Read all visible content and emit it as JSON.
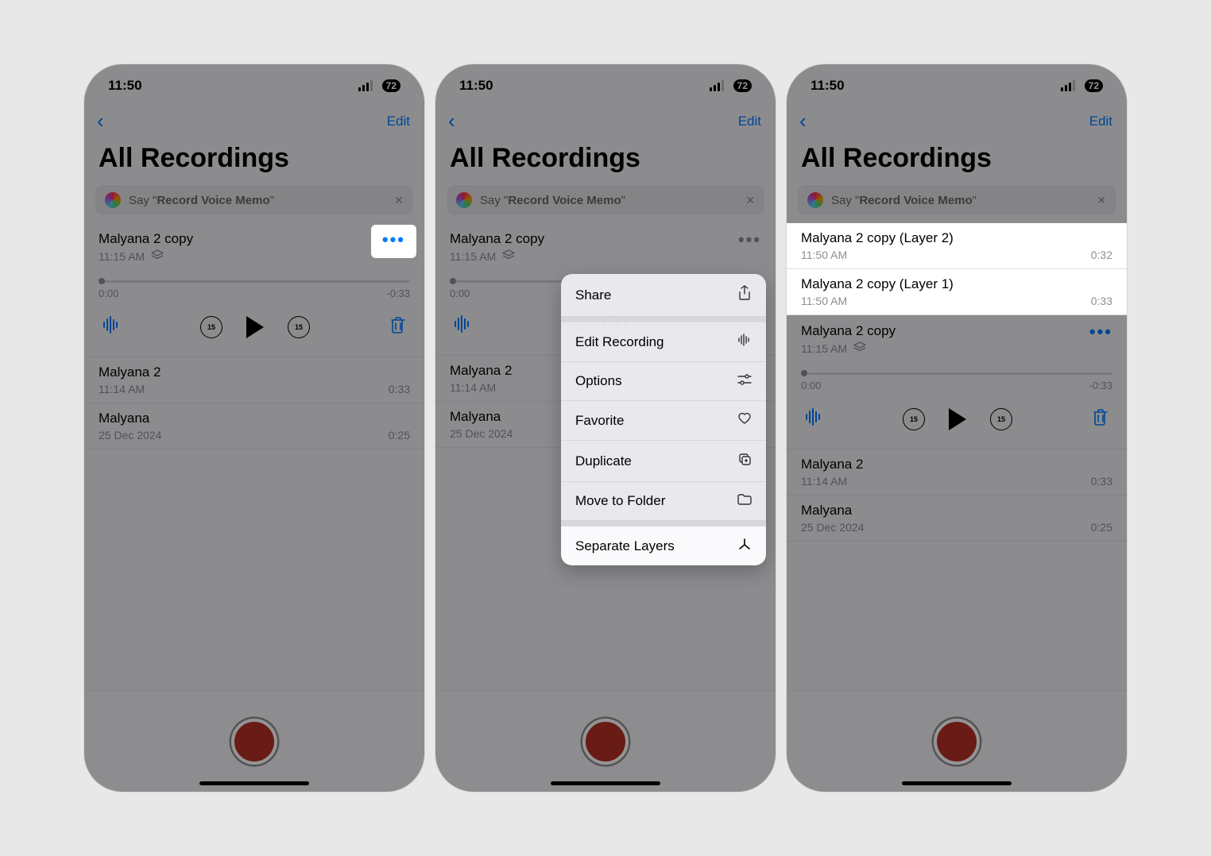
{
  "status": {
    "time": "11:50",
    "battery": "72"
  },
  "nav": {
    "edit": "Edit"
  },
  "title": "All Recordings",
  "siri": {
    "prefix": "Say \"",
    "phrase": "Record Voice Memo",
    "suffix": "\""
  },
  "screen1": {
    "selected": {
      "title": "Malyana 2 copy",
      "time": "11:15 AM",
      "t0": "0:00",
      "t1": "-0:33"
    },
    "items": [
      {
        "title": "Malyana 2",
        "time": "11:14 AM",
        "dur": "0:33"
      },
      {
        "title": "Malyana",
        "time": "25 Dec 2024",
        "dur": "0:25"
      }
    ]
  },
  "screen2": {
    "selected": {
      "title": "Malyana 2 copy",
      "time": "11:15 AM",
      "t0": "0:00"
    },
    "items": [
      {
        "title": "Malyana 2",
        "time": "11:14 AM"
      },
      {
        "title": "Malyana",
        "time": "25 Dec 2024"
      }
    ],
    "menu": {
      "share": "Share",
      "edit": "Edit Recording",
      "options": "Options",
      "favorite": "Favorite",
      "duplicate": "Duplicate",
      "move": "Move to Folder",
      "separate": "Separate Layers"
    }
  },
  "screen3": {
    "layers": [
      {
        "title": "Malyana 2 copy (Layer 2)",
        "time": "11:50 AM",
        "dur": "0:32"
      },
      {
        "title": "Malyana 2 copy (Layer 1)",
        "time": "11:50 AM",
        "dur": "0:33"
      }
    ],
    "selected": {
      "title": "Malyana 2 copy",
      "time": "11:15 AM",
      "t0": "0:00",
      "t1": "-0:33"
    },
    "items": [
      {
        "title": "Malyana 2",
        "time": "11:14 AM",
        "dur": "0:33"
      },
      {
        "title": "Malyana",
        "time": "25 Dec 2024",
        "dur": "0:25"
      }
    ]
  },
  "skip": "15"
}
